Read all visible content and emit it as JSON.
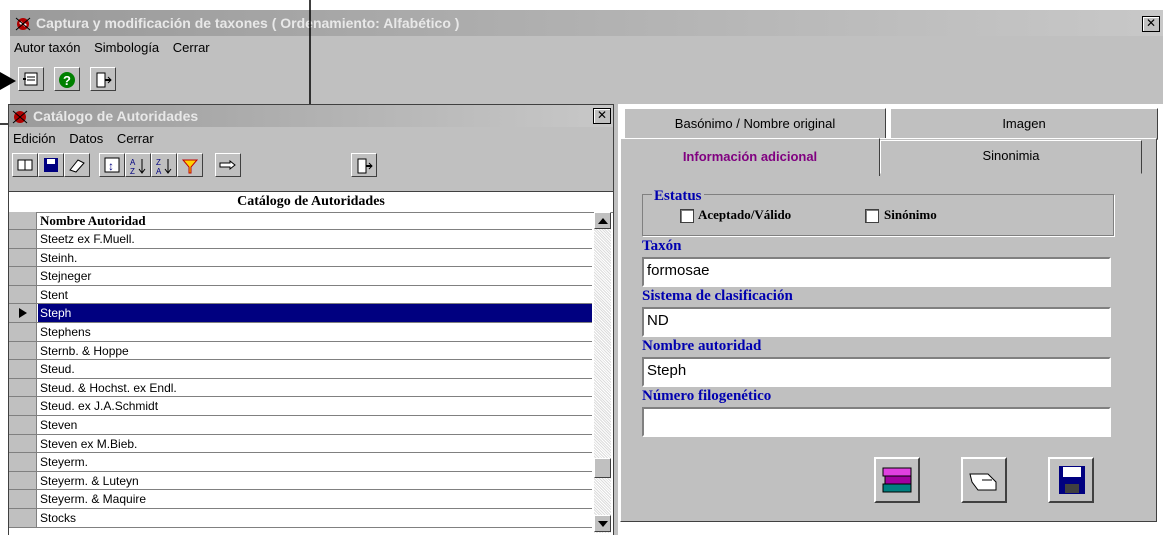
{
  "main_window": {
    "title": "Captura y modificación de taxones  ( Ordenamiento: Alfabético )",
    "close": "✕",
    "menu": [
      "Autor taxón",
      "Simbología",
      "Cerrar"
    ]
  },
  "catalog_window": {
    "title": "Catálogo de Autoridades",
    "close": "✕",
    "menu": [
      "Edición",
      "Datos",
      "Cerrar"
    ],
    "grid_title": "Catálogo de Autoridades",
    "column_header": "Nombre Autoridad",
    "rows": [
      "Steetz ex F.Muell.",
      "Steinh.",
      "Stejneger",
      "Stent",
      "Steph",
      "Stephens",
      "Sternb. & Hoppe",
      "Steud.",
      "Steud. & Hochst. ex Endl.",
      "Steud. ex J.A.Schmidt",
      "Steven",
      "Steven ex M.Bieb.",
      "Steyerm.",
      "Steyerm. & Luteyn",
      "Steyerm. & Maquire",
      "Stocks"
    ],
    "selected_row": "Steph"
  },
  "tabs": {
    "basonimo": "Basónimo / Nombre original",
    "imagen": "Imagen",
    "info": "Información adicional",
    "sinonimia": "Sinonimia"
  },
  "form": {
    "estatus_legend": "Estatus",
    "aceptado": "Aceptado/Válido",
    "sinonimo": "Sinónimo",
    "taxon_label": "Taxón",
    "taxon_value": "formosae",
    "sistema_label": "Sistema de clasificación",
    "sistema_value": "ND",
    "autoridad_label": "Nombre autoridad",
    "autoridad_value": "Steph",
    "numero_label": "Número filogenético",
    "numero_value": ""
  },
  "colors": {
    "selection": "#000080",
    "label_blue": "#0000b0",
    "tab_active": "#800080"
  }
}
